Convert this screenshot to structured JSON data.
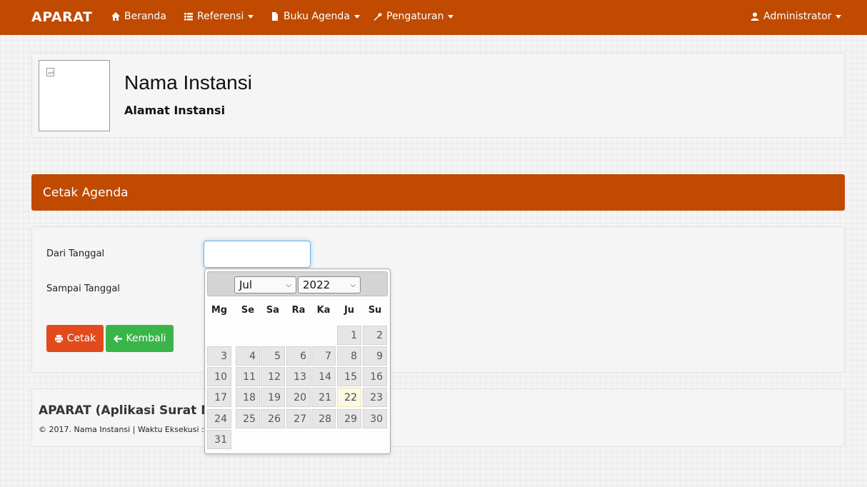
{
  "navbar": {
    "brand": "APARAT",
    "items": [
      {
        "label": "Beranda",
        "icon": "home-icon"
      },
      {
        "label": "Referensi",
        "icon": "list-icon"
      },
      {
        "label": "Buku Agenda",
        "icon": "file-icon"
      },
      {
        "label": "Pengaturan",
        "icon": "wrench-icon"
      }
    ],
    "user": {
      "label": "Administrator",
      "icon": "user-icon"
    },
    "color": "#bf4a00"
  },
  "institution": {
    "name": "Nama Instansi",
    "address": "Alamat Instansi"
  },
  "panel": {
    "title": "Cetak Agenda"
  },
  "form": {
    "from_label": "Dari Tanggal",
    "to_label": "Sampai Tanggal",
    "from_value": "",
    "print_label": "Cetak",
    "back_label": "Kembali"
  },
  "footer": {
    "title": "APARAT (Aplikasi Surat Me",
    "meta": "© 2017. Nama Instansi | Waktu Eksekusi : 0"
  },
  "datepicker": {
    "month": "Jul",
    "year": "2022",
    "weekdays": [
      "Mg",
      "Se",
      "Sa",
      "Ra",
      "Ka",
      "Ju",
      "Su"
    ],
    "days": [
      "1",
      "2",
      "3",
      "4",
      "5",
      "6",
      "7",
      "8",
      "9",
      "10",
      "11",
      "12",
      "13",
      "14",
      "15",
      "16",
      "17",
      "18",
      "19",
      "20",
      "21",
      "22",
      "23",
      "24",
      "25",
      "26",
      "27",
      "28",
      "29",
      "30",
      "31"
    ],
    "today": "22"
  }
}
